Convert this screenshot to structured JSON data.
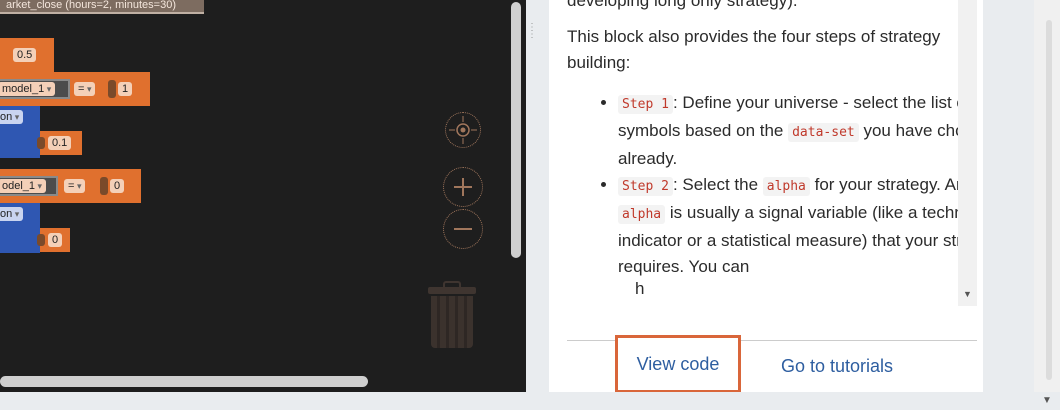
{
  "workspace": {
    "top_block_text": "arket_close (hours=2, minutes=30)",
    "rows": {
      "num_05": "0.5",
      "model_1_a": "model_1",
      "eq_a": "=",
      "num_1": "1",
      "on_a": "on",
      "num_01": "0.1",
      "model_1_b": "odel_1",
      "eq_b": "=",
      "num_0a": "0",
      "on_b": "on",
      "num_0b": "0"
    },
    "controls": {
      "recenter_icon": "target-icon",
      "zoom_in_icon": "plus-icon",
      "zoom_out_icon": "minus-icon",
      "trash_icon": "trash-icon"
    }
  },
  "panel": {
    "para_top": "developing long only strategy).",
    "para_intro": "This block also provides the four steps of strategy building:",
    "steps": [
      {
        "code": "Step 1",
        "t1": ": Define your universe - select the list of symbols based on the ",
        "code2": "data-set",
        "t2": " you have chose already."
      },
      {
        "code": "Step 2",
        "t1": ": Select the ",
        "code2": "alpha",
        "t2": " for your strategy. An ",
        "code3": "alpha",
        "t3": " is usually a signal variable (like a technical indicator or a statistical measure) that your strategy requires. You can"
      }
    ],
    "tail_partial": "h",
    "buttons": {
      "view_code": "View code",
      "tutorials": "Go to tutorials"
    }
  },
  "colors": {
    "workspace_bg": "#1e1e1e",
    "block_orange": "#e0702e",
    "block_blue": "#2f57b2",
    "link_blue": "#2e5ea0",
    "highlight_border": "#d9663a",
    "code_red": "#c0392b"
  }
}
